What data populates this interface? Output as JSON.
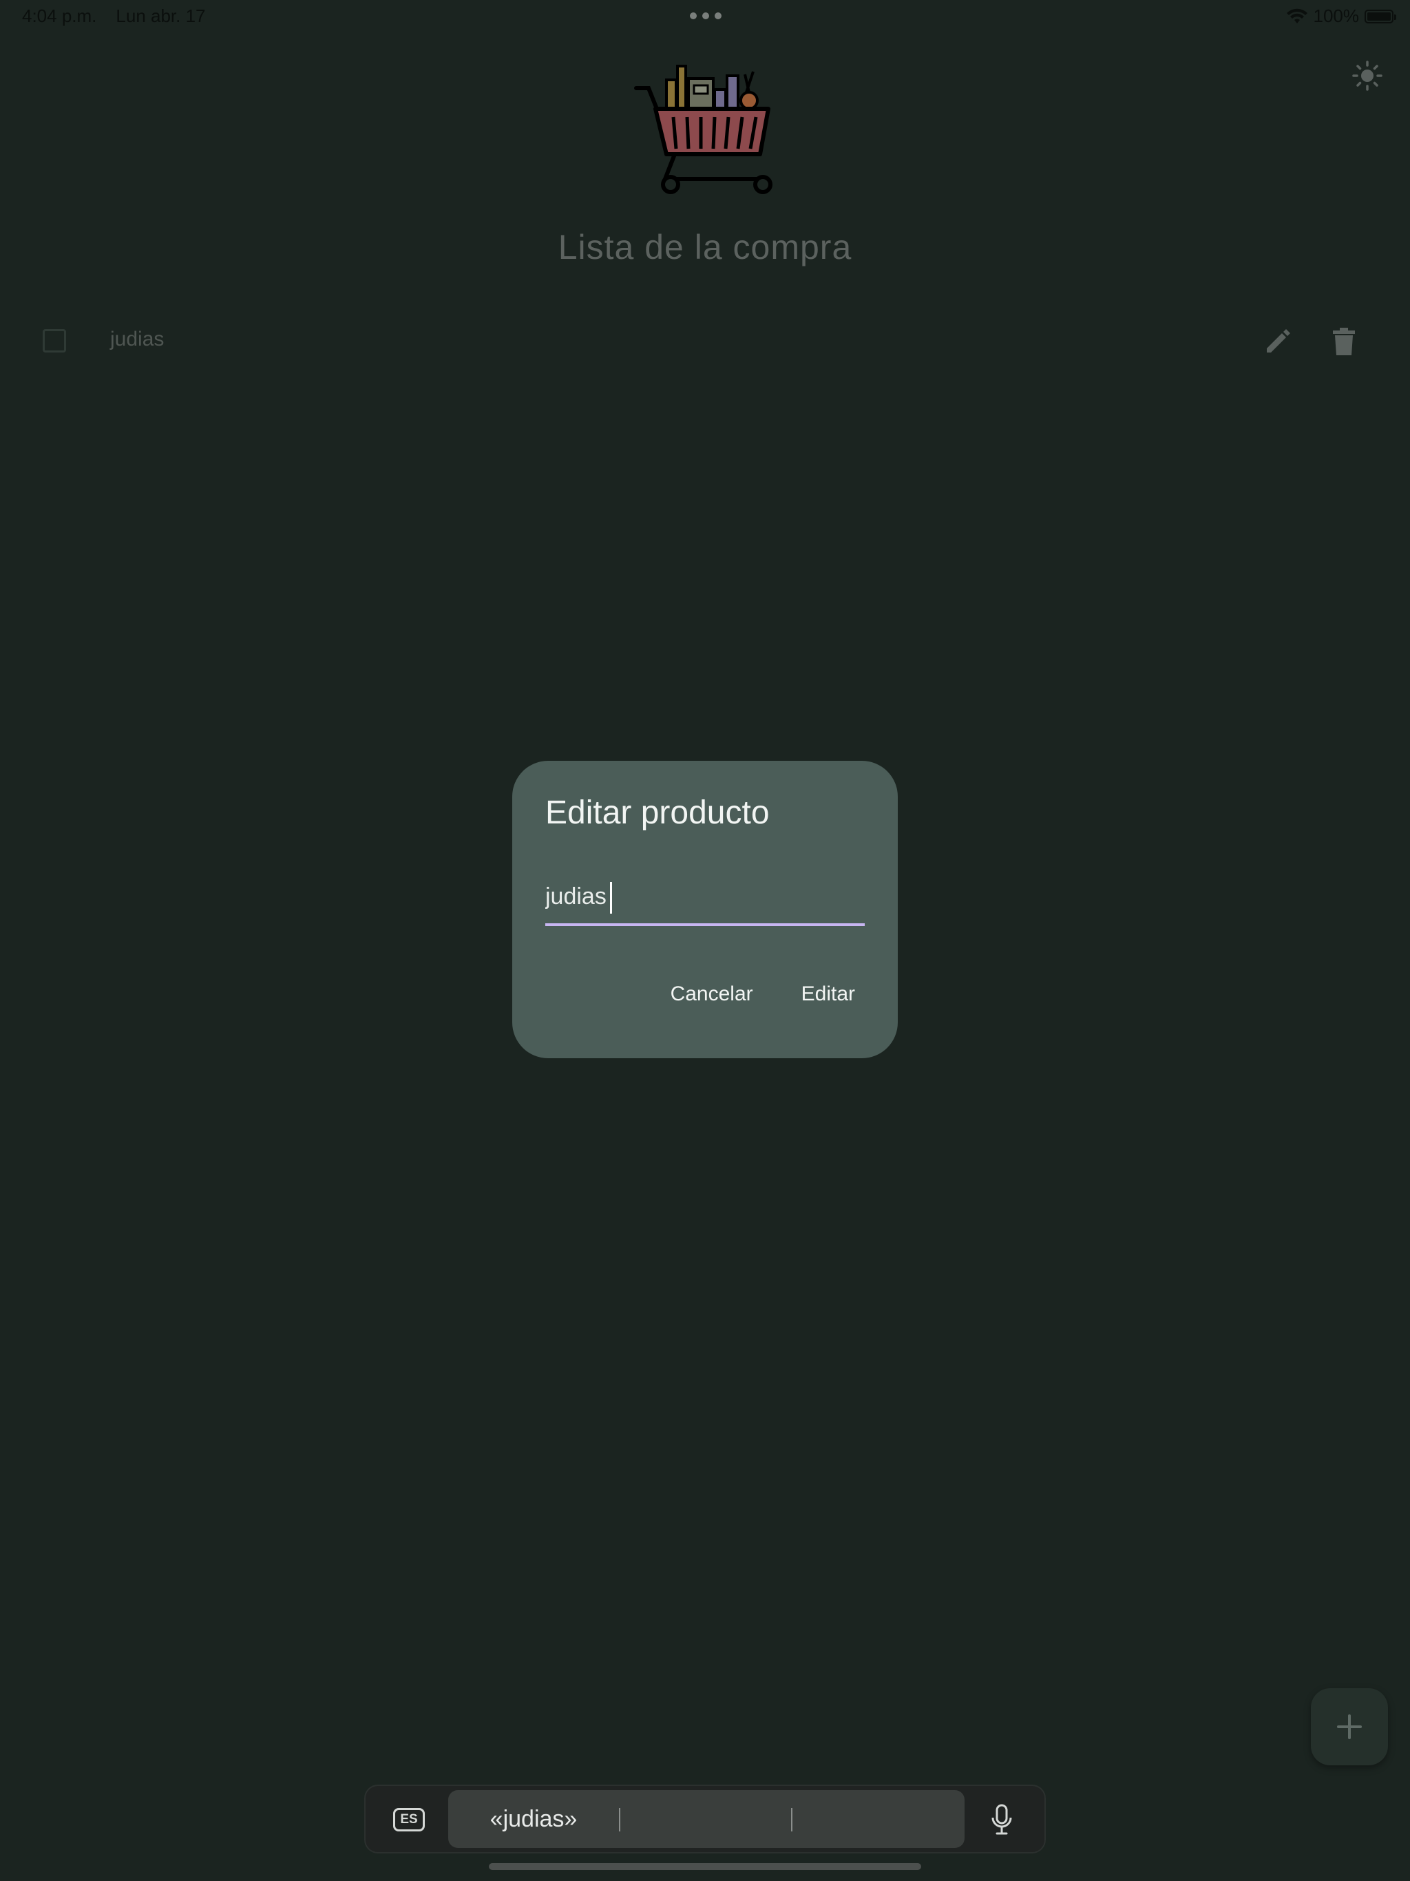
{
  "status_bar": {
    "time": "4:04 p.m.",
    "date": "Lun abr. 17",
    "battery": "100%"
  },
  "app": {
    "title": "Lista de la compra"
  },
  "list": {
    "items": [
      {
        "label": "judias",
        "checked": false
      }
    ]
  },
  "dialog": {
    "title": "Editar producto",
    "input_value": "judias",
    "cancel_label": "Cancelar",
    "confirm_label": "Editar"
  },
  "keyboard_bar": {
    "language": "ES",
    "suggestions": [
      "«judias»",
      "",
      ""
    ]
  },
  "colors": {
    "background": "#1b2420",
    "dialog_bg": "#4b5d58",
    "input_underline": "#c8b6f2",
    "cart_basket": "#8d4a4d"
  },
  "icons": {
    "theme": "sun-icon",
    "edit": "pencil-icon",
    "delete": "trash-icon",
    "add": "plus-icon",
    "mic": "microphone-icon",
    "wifi": "wifi-icon"
  }
}
